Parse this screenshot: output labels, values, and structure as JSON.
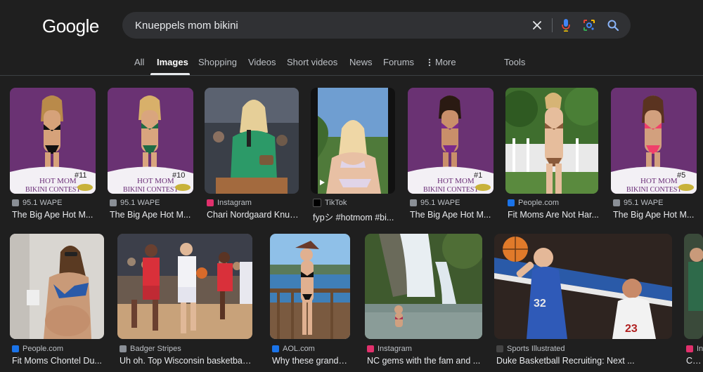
{
  "logo": "Google",
  "search": {
    "query": "Knueppels mom bikini"
  },
  "icons": {
    "clear": "close-icon",
    "voice": "microphone-icon",
    "lens": "lens-icon",
    "search": "search-icon",
    "more": "more-vert-icon"
  },
  "colors": {
    "accent": "#8ab4f8",
    "background": "#1f1f1f",
    "searchbar": "#303134"
  },
  "tabs": [
    {
      "label": "All"
    },
    {
      "label": "Images",
      "active": true
    },
    {
      "label": "Shopping"
    },
    {
      "label": "Videos"
    },
    {
      "label": "Short videos"
    },
    {
      "label": "News"
    },
    {
      "label": "Forums"
    },
    {
      "label": "More"
    },
    {
      "label": "Tools"
    }
  ],
  "results": [
    {
      "source": "95.1 WAPE",
      "caption": "The Big Ape Hot M...",
      "badge": "#11",
      "banner": "HOT MOM\nBIKINI CONTEST"
    },
    {
      "source": "95.1 WAPE",
      "caption": "The Big Ape Hot M...",
      "badge": "#10",
      "banner": "HOT MOM\nBIKINI CONTEST"
    },
    {
      "source": "Instagram",
      "caption": "Chari Nordgaard Knue..."
    },
    {
      "source": "TikTok",
      "caption": "fypシ #hotmom #bi..."
    },
    {
      "source": "95.1 WAPE",
      "caption": "The Big Ape Hot M...",
      "badge": "#1",
      "banner": "HOT MOM\nBIKINI CONTEST"
    },
    {
      "source": "People.com",
      "caption": "Fit Moms Are Not Har..."
    },
    {
      "source": "95.1 WAPE",
      "caption": "The Big Ape Hot M...",
      "badge": "#5",
      "banner": "HOT MOM\nBIKINI CONTEST"
    },
    {
      "source": "People.com",
      "caption": "Fit Moms Chontel Du..."
    },
    {
      "source": "Badger Stripes",
      "caption": "Uh oh. Top Wisconsin basketball r..."
    },
    {
      "source": "AOL.com",
      "caption": "Why these grandma..."
    },
    {
      "source": "Instagram",
      "caption": "NC gems with the fam and ..."
    },
    {
      "source": "Sports Illustrated",
      "caption": "Duke Basketball Recruiting: Next ..."
    },
    {
      "source": "In",
      "caption": "Chai"
    }
  ]
}
